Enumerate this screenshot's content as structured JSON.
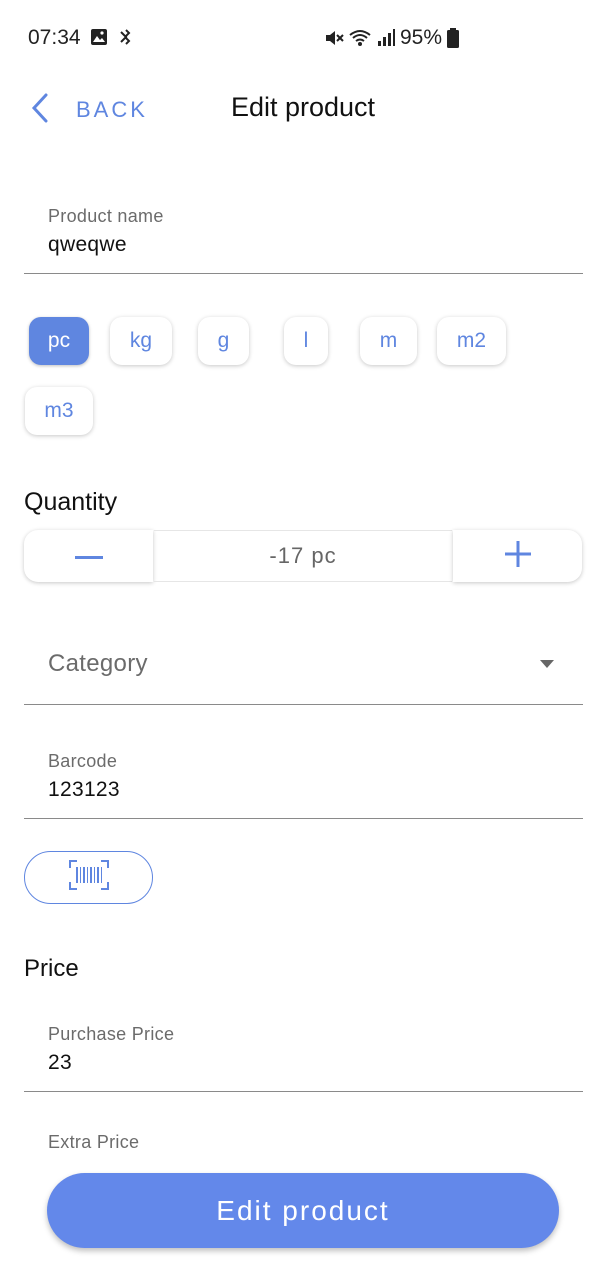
{
  "status_bar": {
    "time": "07:34",
    "battery": "95%",
    "icons": [
      "gallery-icon",
      "sync-icon",
      "mute-icon",
      "wifi-icon",
      "signal-icon",
      "battery-icon"
    ]
  },
  "header": {
    "back_label": "BACK",
    "title": "Edit product"
  },
  "product_name": {
    "label": "Product name",
    "value": "qweqwe"
  },
  "units": {
    "options": [
      "pc",
      "kg",
      "g",
      "l",
      "m",
      "m2",
      "m3"
    ],
    "selected": "pc"
  },
  "quantity": {
    "title": "Quantity",
    "value": "-17 pc",
    "minus_icon": "minus-icon",
    "plus_icon": "plus-icon"
  },
  "category": {
    "placeholder": "Category"
  },
  "barcode": {
    "label": "Barcode",
    "value": "123123",
    "scan_icon": "barcode-scan-icon"
  },
  "price": {
    "title": "Price",
    "purchase_label": "Purchase Price",
    "purchase_value": "23",
    "extra_label": "Extra Price"
  },
  "submit": {
    "label": "Edit product"
  },
  "colors": {
    "accent": "#5f86e0",
    "primary_button": "#6388ea",
    "divider": "#8a8a8a"
  }
}
